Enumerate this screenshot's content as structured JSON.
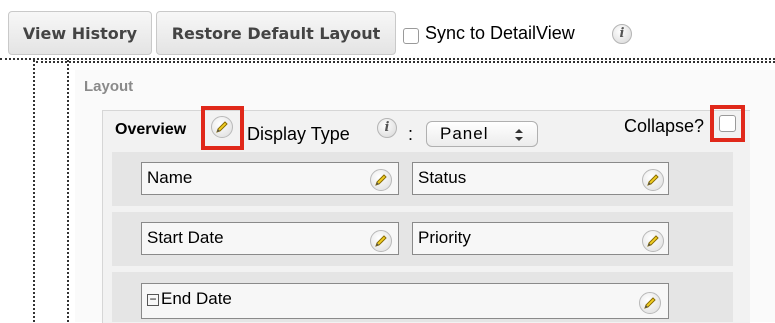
{
  "toolbar": {
    "view_history": "View History",
    "restore_layout": "Restore Default Layout",
    "sync_label": "Sync to DetailView",
    "info_glyph": "i"
  },
  "layout": {
    "heading": "Layout",
    "panel": {
      "name": "Overview",
      "display_type_label": "Display Type",
      "colon": ":",
      "display_type_value": "Panel",
      "collapse_label": "Collapse?"
    },
    "rows": [
      {
        "fields": [
          {
            "label": "Name"
          },
          {
            "label": "Status"
          }
        ]
      },
      {
        "fields": [
          {
            "label": "Start Date"
          },
          {
            "label": "Priority"
          }
        ]
      },
      {
        "fields": [
          {
            "label": "End Date",
            "minus": "−"
          }
        ]
      }
    ]
  },
  "colors": {
    "highlight": "#e0281a",
    "row_background": "#e5e5e5",
    "panel_background": "#f2f2f2"
  },
  "icons": [
    "info-icon",
    "pencil-icon",
    "checkbox",
    "select-arrows-icon",
    "minus-icon"
  ]
}
